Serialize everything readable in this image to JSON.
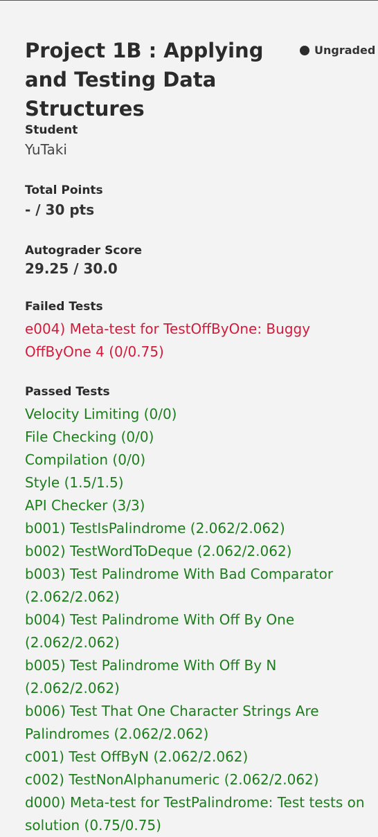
{
  "header": {
    "title": "Project 1B : Applying and Testing Data Structures",
    "status": "Ungraded"
  },
  "student": {
    "label": "Student",
    "value": "YuTaki"
  },
  "total_points": {
    "label": "Total Points",
    "value": "- / 30 pts"
  },
  "autograder_score": {
    "label": "Autograder Score",
    "value": "29.25 / 30.0"
  },
  "failed_tests": {
    "label": "Failed Tests",
    "items": [
      "e004) Meta-test for TestOffByOne: Buggy OffByOne 4 (0/0.75)"
    ]
  },
  "passed_tests": {
    "label": "Passed Tests",
    "items": [
      "Velocity Limiting (0/0)",
      "File Checking (0/0)",
      "Compilation (0/0)",
      "Style (1.5/1.5)",
      "API Checker (3/3)",
      "b001) TestIsPalindrome (2.062/2.062)",
      "b002) TestWordToDeque (2.062/2.062)",
      "b003) Test Palindrome With Bad Comparator (2.062/2.062)",
      "b004) Test Palindrome With Off By One (2.062/2.062)",
      "b005) Test Palindrome With Off By N (2.062/2.062)",
      "b006) Test That One Character Strings Are Palindromes (2.062/2.062)",
      "c001) Test OffByN (2.062/2.062)",
      "c002) TestNonAlphanumeric (2.062/2.062)",
      "d000) Meta-test for TestPalindrome: Test tests on solution (0.75/0.75)"
    ]
  }
}
